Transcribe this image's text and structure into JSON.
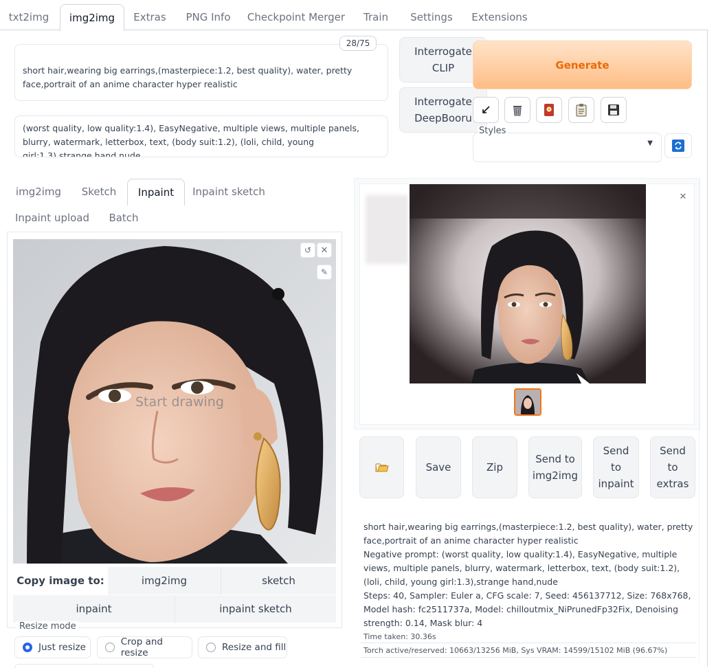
{
  "top_tabs": [
    "txt2img",
    "img2img",
    "Extras",
    "PNG Info",
    "Checkpoint Merger",
    "Train",
    "Settings",
    "Extensions"
  ],
  "active_top_tab": "img2img",
  "prompt": {
    "value": "short hair,wearing big earrings,(masterpiece:1.2, best quality), water, pretty face,portrait of an anime character hyper realistic",
    "token_count": "28/75"
  },
  "negative_prompt": {
    "value": "(worst quality, low quality:1.4), EasyNegative, multiple views, multiple panels, blurry, watermark, letterbox, text, (body suit:1.2), (loli, child, young girl:1.3),strange hand,nude"
  },
  "interrogate": {
    "clip_label": "Interrogate CLIP",
    "deepbooru_label": "Interrogate DeepBooru"
  },
  "generate_label": "Generate",
  "tool_buttons": [
    "arrow-diagonal-icon",
    "trash-icon",
    "card-icon",
    "clipboard-icon",
    "save-icon"
  ],
  "styles": {
    "label": "Styles",
    "value": ""
  },
  "sub_tabs": [
    "img2img",
    "Sketch",
    "Inpaint",
    "Inpaint sketch",
    "Inpaint upload",
    "Batch"
  ],
  "active_sub_tab": "Inpaint",
  "canvas": {
    "placeholder": "Start drawing"
  },
  "copy_image": {
    "label": "Copy image to:",
    "targets": [
      "img2img",
      "sketch",
      "inpaint",
      "inpaint sketch"
    ]
  },
  "resize_mode": {
    "label": "Resize mode",
    "options": [
      "Just resize",
      "Crop and resize",
      "Resize and fill"
    ],
    "selected": "Just resize"
  },
  "action_buttons": {
    "folder_icon": "folder-icon",
    "save": "Save",
    "zip": "Zip",
    "send_img2img": "Send to img2img",
    "send_inpaint": "Send to inpaint",
    "send_extras": "Send to extras"
  },
  "generation_info": {
    "prompt": "short hair,wearing big earrings,(masterpiece:1.2, best quality), water, pretty face,portrait of an anime character hyper realistic",
    "negative": "Negative prompt: (worst quality, low quality:1.4), EasyNegative, multiple views, multiple panels, blurry, watermark, letterbox, text, (body suit:1.2), (loli, child, young girl:1.3),strange hand,nude",
    "params": "Steps: 40, Sampler: Euler a, CFG scale: 7, Seed: 456137712, Size: 768x768, Model hash: fc2511737a, Model: chilloutmix_NiPrunedFp32Fix, Denoising strength: 0.14, Mask blur: 4",
    "time_taken": "Time taken: 30.36s",
    "vram": "Torch active/reserved: 10663/13256 MiB, Sys VRAM: 14599/15102 MiB (96.67%)"
  },
  "colors": {
    "accent": "#ea6a08",
    "generate_bg": "#ffc48f",
    "radio_selected": "#2563eb",
    "thumbnail_border": "#f97316"
  }
}
